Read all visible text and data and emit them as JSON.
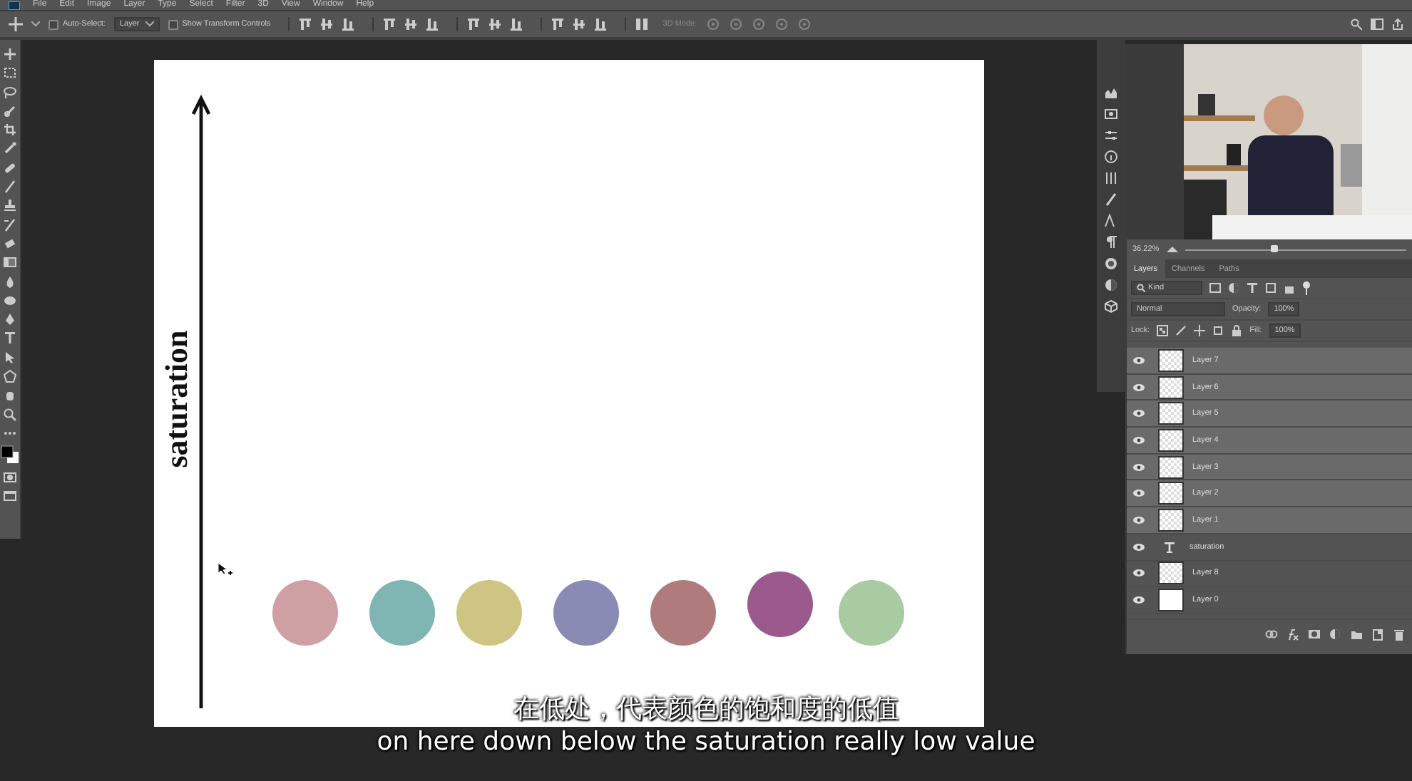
{
  "menu": [
    "File",
    "Edit",
    "Image",
    "Layer",
    "Type",
    "Select",
    "Filter",
    "3D",
    "View",
    "Window",
    "Help"
  ],
  "options_bar": {
    "auto_select": {
      "label": "Auto-Select:",
      "checked": false
    },
    "auto_select_target": "Layer",
    "transform_controls": {
      "label": "Show Transform Controls",
      "checked": false
    },
    "mode_label": "3D Mode:"
  },
  "canvas": {
    "axis_label": "saturation",
    "swatches": [
      {
        "color": "#cfa0a3"
      },
      {
        "color": "#7fb5b2"
      },
      {
        "color": "#cfc583"
      },
      {
        "color": "#8a8bb5"
      },
      {
        "color": "#b07b7d"
      },
      {
        "color": "#9a5a8e"
      },
      {
        "color": "#a9cba1"
      }
    ]
  },
  "navigator": {
    "zoom": "36.22%",
    "level": 0.4
  },
  "layers_panel": {
    "tabs": [
      {
        "label": "Layers",
        "selected": true
      },
      {
        "label": "Channels",
        "selected": false
      },
      {
        "label": "Paths",
        "selected": false
      }
    ],
    "filter": "Kind",
    "blend_mode": "Normal",
    "opacity_label": "Opacity:",
    "opacity": "100%",
    "lock_label": "Lock:",
    "fill_label": "Fill:",
    "fill": "100%",
    "layers": [
      {
        "name": "Layer 7",
        "kind": "pixel",
        "selected": true,
        "visible": true
      },
      {
        "name": "Layer 6",
        "kind": "pixel",
        "selected": true,
        "visible": true
      },
      {
        "name": "Layer 5",
        "kind": "pixel",
        "selected": true,
        "visible": true
      },
      {
        "name": "Layer 4",
        "kind": "pixel",
        "selected": true,
        "visible": true
      },
      {
        "name": "Layer 3",
        "kind": "pixel",
        "selected": true,
        "visible": true
      },
      {
        "name": "Layer 2",
        "kind": "pixel",
        "selected": true,
        "visible": true
      },
      {
        "name": "Layer 1",
        "kind": "pixel",
        "selected": true,
        "visible": true
      },
      {
        "name": "saturation",
        "kind": "text",
        "selected": false,
        "visible": true
      },
      {
        "name": "Layer 8",
        "kind": "pixel",
        "selected": false,
        "visible": true
      },
      {
        "name": "Layer 0",
        "kind": "fill",
        "selected": false,
        "visible": true
      }
    ]
  },
  "subtitles": [
    "在低处，代表颜色的饱和度的低值",
    "on here down below the saturation really low value"
  ]
}
